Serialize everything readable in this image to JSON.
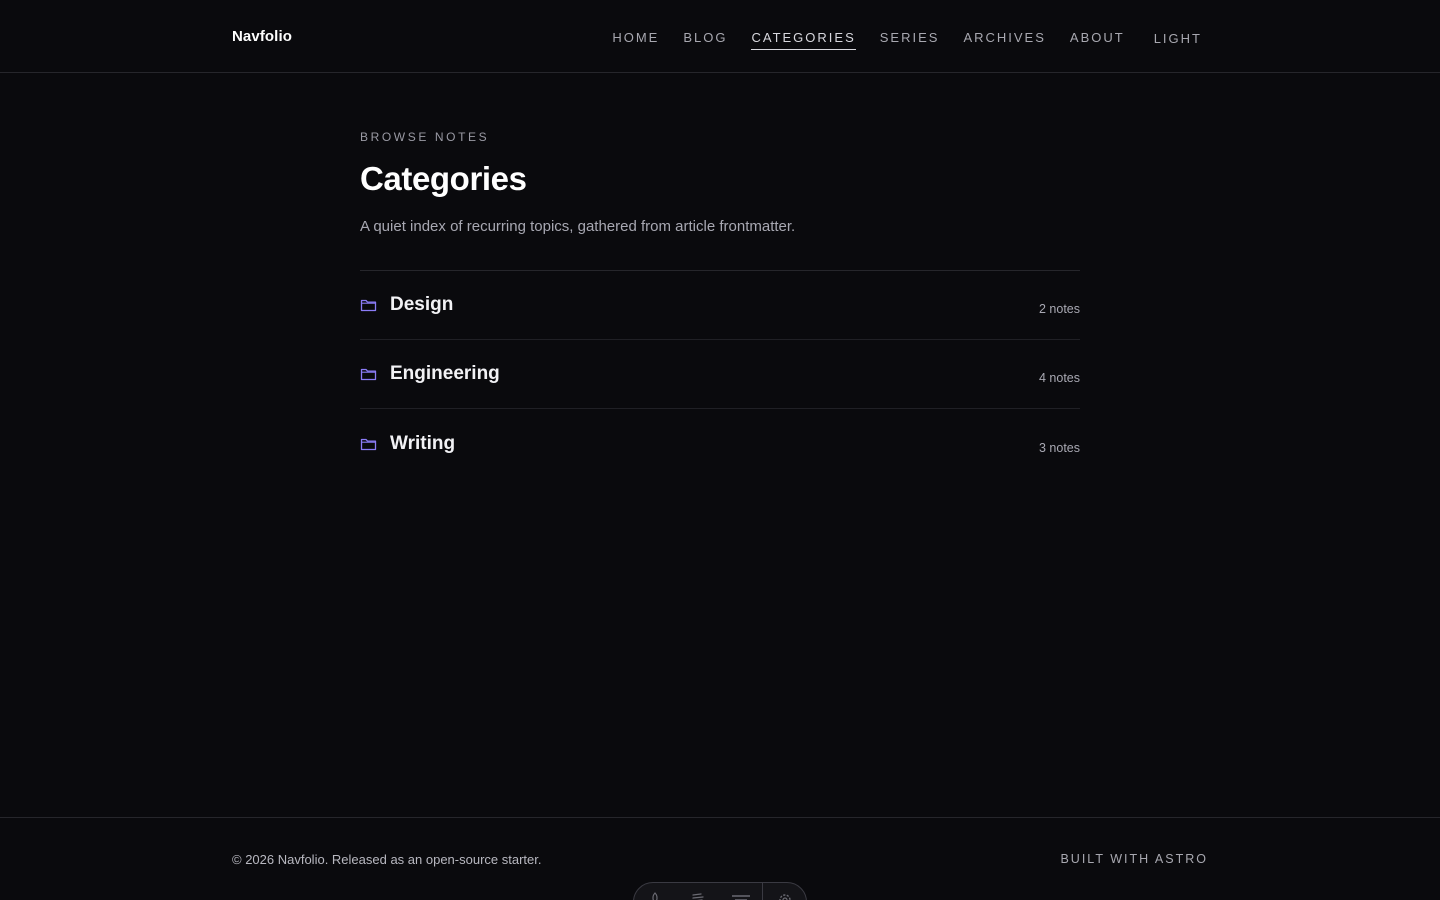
{
  "site": {
    "brand": "Navfolio"
  },
  "nav": {
    "items": [
      {
        "label": "HOME"
      },
      {
        "label": "BLOG"
      },
      {
        "label": "CATEGORIES"
      },
      {
        "label": "SERIES"
      },
      {
        "label": "ARCHIVES"
      },
      {
        "label": "ABOUT"
      }
    ],
    "active": "CATEGORIES",
    "theme_toggle": "LIGHT"
  },
  "main": {
    "eyebrow": "BROWSE NOTES",
    "title": "Categories",
    "lede": "A quiet index of recurring topics, gathered from article frontmatter.",
    "categories": [
      {
        "name": "Design",
        "count": "2 notes"
      },
      {
        "name": "Engineering",
        "count": "4 notes"
      },
      {
        "name": "Writing",
        "count": "3 notes"
      }
    ]
  },
  "footer": {
    "copyright": "© 2026 Navfolio. Released as an open-source starter.",
    "built_with": "BUILT WITH ASTRO"
  },
  "dev_toolbar": {
    "icons": [
      "rocket-icon",
      "menu-icon",
      "list-icon",
      "gear-icon"
    ]
  },
  "colors": {
    "background": "#0a0a0d",
    "accent": "#8b7cf6",
    "border": "#26262b"
  }
}
